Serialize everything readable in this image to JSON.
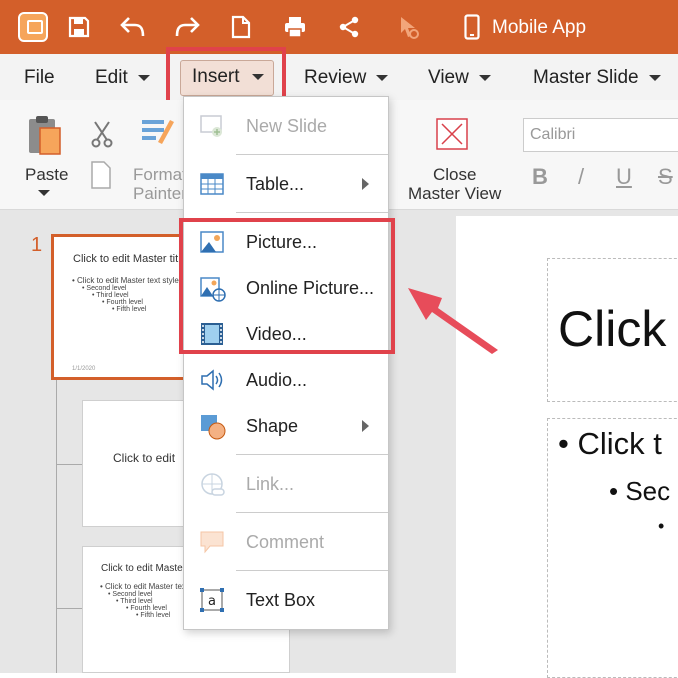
{
  "titlebar": {
    "mobile_app_label": "Mobile App",
    "icons": [
      "app-logo",
      "save-icon",
      "undo-icon",
      "redo-icon",
      "new-document-icon",
      "print-icon",
      "share-icon",
      "touch-mode-icon",
      "mobile-icon"
    ]
  },
  "menubar": {
    "file": "File",
    "edit": "Edit",
    "insert": "Insert",
    "review": "Review",
    "view": "View",
    "master_slide": "Master Slide"
  },
  "ribbon": {
    "paste": "Paste",
    "format_painter_line1": "Format",
    "format_painter_line2": "Painter",
    "close_master_view_line1": "Close",
    "close_master_view_line2": "Master View",
    "font_name": "Calibri",
    "bold": "B",
    "italic": "/",
    "underline": "U",
    "strikethrough": "S"
  },
  "insert_menu": {
    "new_slide": "New Slide",
    "table": "Table...",
    "picture": "Picture...",
    "online_picture": "Online Picture...",
    "video": "Video...",
    "audio": "Audio...",
    "shape": "Shape",
    "link": "Link...",
    "comment": "Comment",
    "text_box": "Text Box"
  },
  "thumbnails": {
    "slide_number": "1",
    "slide1_title": "Click to edit Master tit",
    "slide1_body": "• Click to edit Master text styles",
    "slide1_l2": "• Second level",
    "slide1_l3": "• Third level",
    "slide1_l4": "• Fourth level",
    "slide1_l5": "• Fifth level",
    "slide1_footer": "1/1/2020",
    "slide2_title": "Click to edit",
    "slide3_title": "Click to edit Master",
    "slide3_body": "• Click to edit Master text styles",
    "slide3_l2": "• Second level",
    "slide3_l3": "• Third level",
    "slide3_l4": "• Fourth level",
    "slide3_l5": "• Fifth level"
  },
  "canvas": {
    "title_text": "Click",
    "bullet1": "• Click t",
    "bullet2": "• Sec",
    "bullet3": "•"
  },
  "colors": {
    "accent": "#d35f2a",
    "highlight": "#e0424b"
  }
}
